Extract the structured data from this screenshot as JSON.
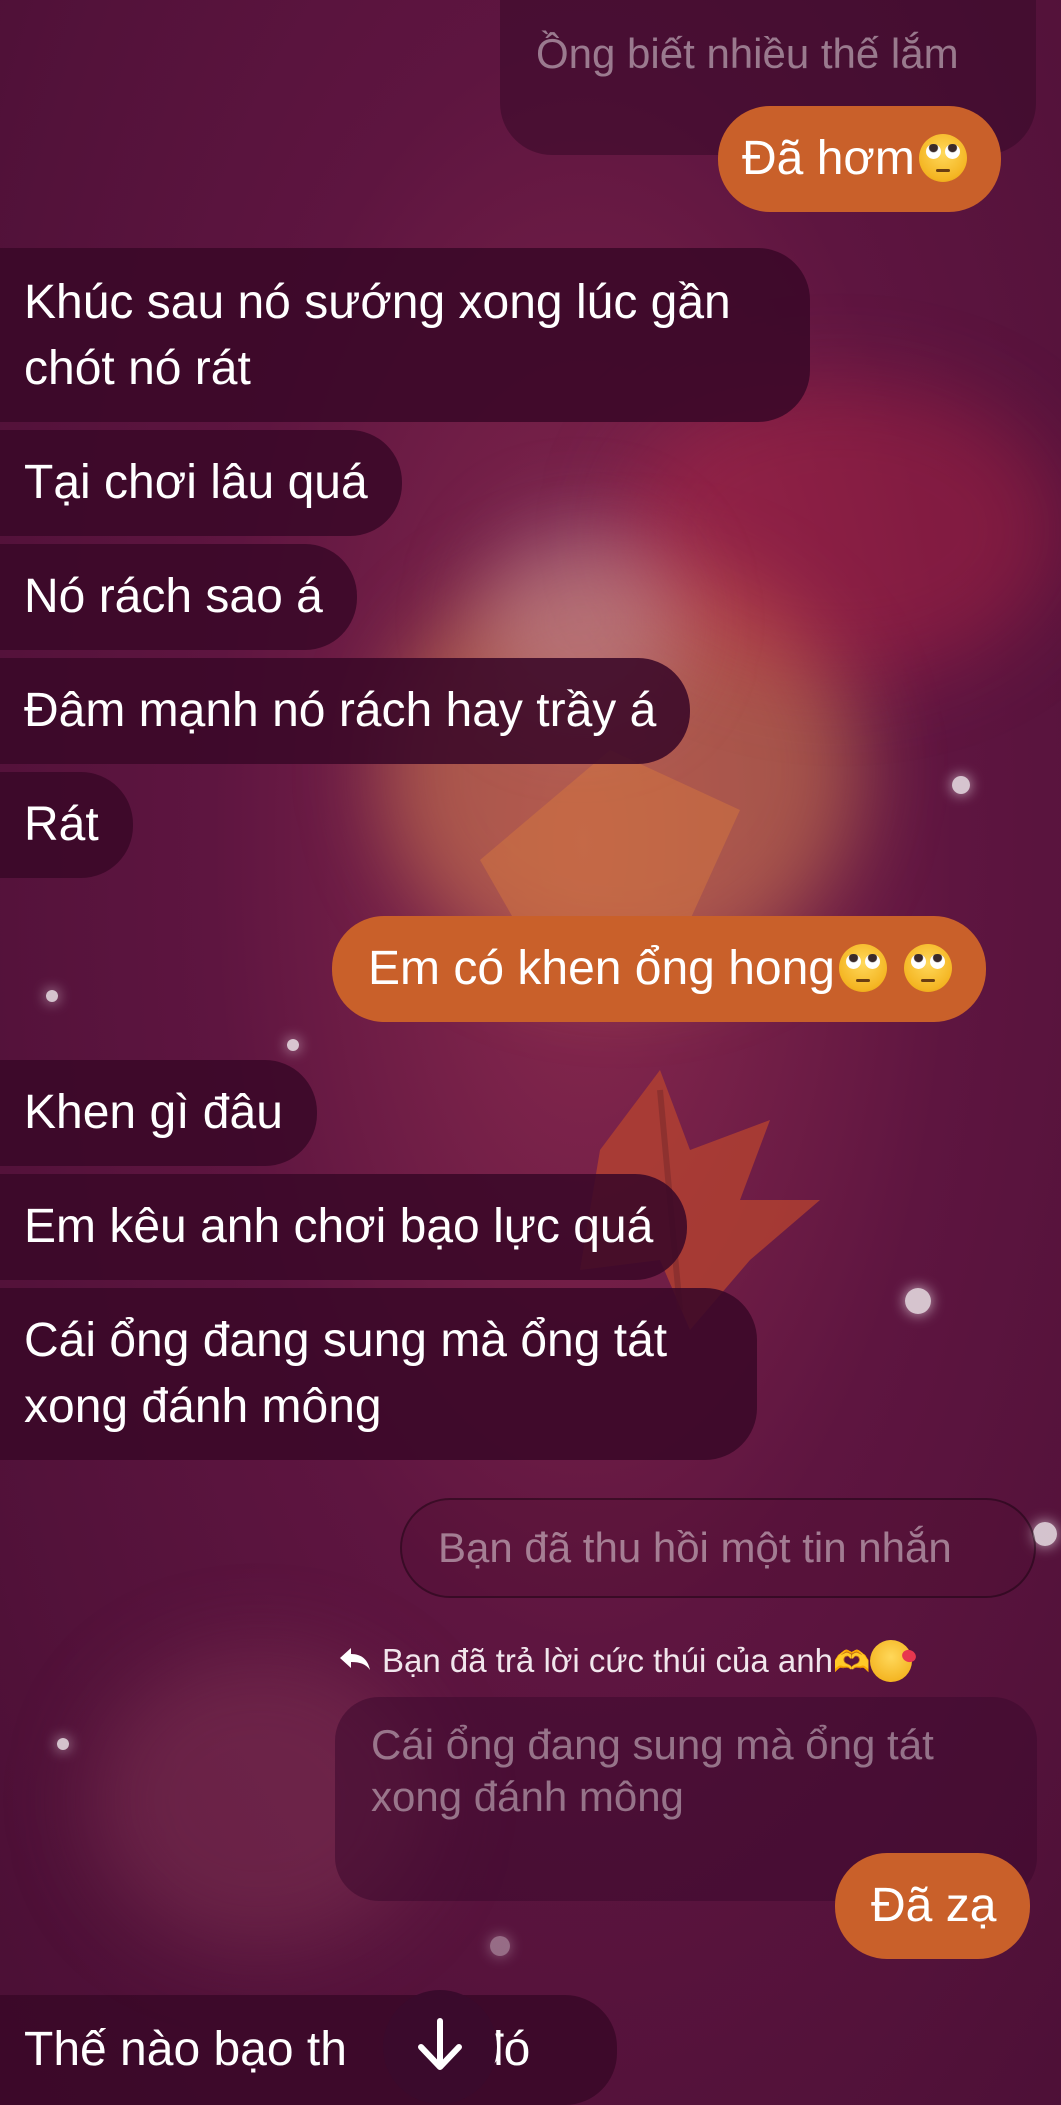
{
  "messages": {
    "m1": "Ồng biết nhiều thế lắm",
    "m2": "Đã hơm",
    "m3": "Khúc sau nó sướng xong lúc gần chót nó rát",
    "m4": "Tại chơi lâu quá",
    "m5": "Nó rách sao á",
    "m6": "Đâm mạnh nó rách hay trầy á",
    "m7": "Rát",
    "m8": "Em có khen ổng hong",
    "m9": "Khen gì đâu",
    "m10": "Em kêu anh chơi bạo lực quá",
    "m11": "Cái ổng đang sung mà ổng tát xong đánh mông",
    "m12": "Đã zạ",
    "m13_start": "Thế nào bạo th",
    "m13_end": "ế đó"
  },
  "recalled_notice": "Bạn đã thu hồi một tin nhắn",
  "reply": {
    "header": "Bạn đã trả lời cức thúi của anh",
    "quoted_text": "Cái ổng đang sung mà ổng tát xong đánh mông"
  },
  "colors": {
    "incoming_bubble": "#3a0828",
    "outgoing_bubble": "#c9602a",
    "background": "#5e1540"
  },
  "icons": {
    "reply": "reply-arrow-icon",
    "scroll": "arrow-down-icon",
    "emoji_eyes": "face-with-rolling-eyes-emoji"
  }
}
